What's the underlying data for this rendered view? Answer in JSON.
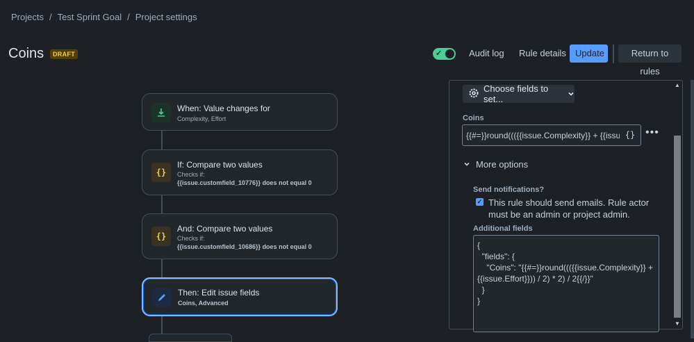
{
  "breadcrumb": {
    "projects": "Projects",
    "sep1": "/",
    "project": "Test Sprint Goal",
    "sep2": "/",
    "settings": "Project settings"
  },
  "header": {
    "title": "Coins",
    "status_badge": "DRAFT",
    "enabled_toggle": true,
    "audit_log": "Audit log",
    "rule_details": "Rule details",
    "update": "Update",
    "return_to_rules": "Return to rules"
  },
  "rule": {
    "trigger": {
      "title": "When: Value changes for",
      "subtitle": "Complexity, Effort",
      "icon": "field-change-icon"
    },
    "condition1": {
      "title": "If: Compare two values",
      "checks_label": "Checks if:",
      "expression": "{{issue.customfield_10776}} does not equal 0",
      "icon": "curly-braces-icon"
    },
    "condition2": {
      "title": "And: Compare two values",
      "checks_label": "Checks if:",
      "expression": "{{issue.customfield_10686}} does not equal 0",
      "icon": "curly-braces-icon"
    },
    "action": {
      "title": "Then: Edit issue fields",
      "subtitle": "Coins, Advanced",
      "icon": "pencil-icon"
    }
  },
  "panel": {
    "choose_fields": "Choose fields to set...",
    "coins_label": "Coins",
    "coins_value": "{{#=}}round((({{issue.Complexity}} + {{issue.Effort}})",
    "braces_button": "{}",
    "more_menu": "•••",
    "more_options": "More options",
    "send_notifications_label": "Send notifications?",
    "send_notifications_checked": true,
    "send_notifications_text": "This rule should send emails. Rule actor must be an admin or project admin.",
    "additional_fields_label": "Additional fields",
    "additional_fields_value": "{\n  \"fields\": {\n    \"Coins\": \"{{#=}}round((({{issue.Complexity}} +\n{{issue.Effort}})) / 2) * 2) / 2{{/}}\"\n  }\n}"
  },
  "colors": {
    "background": "#1d2125",
    "accent_blue": "#579dff",
    "toggle_green": "#4bce97",
    "draft_badge": "#f5cd47"
  }
}
